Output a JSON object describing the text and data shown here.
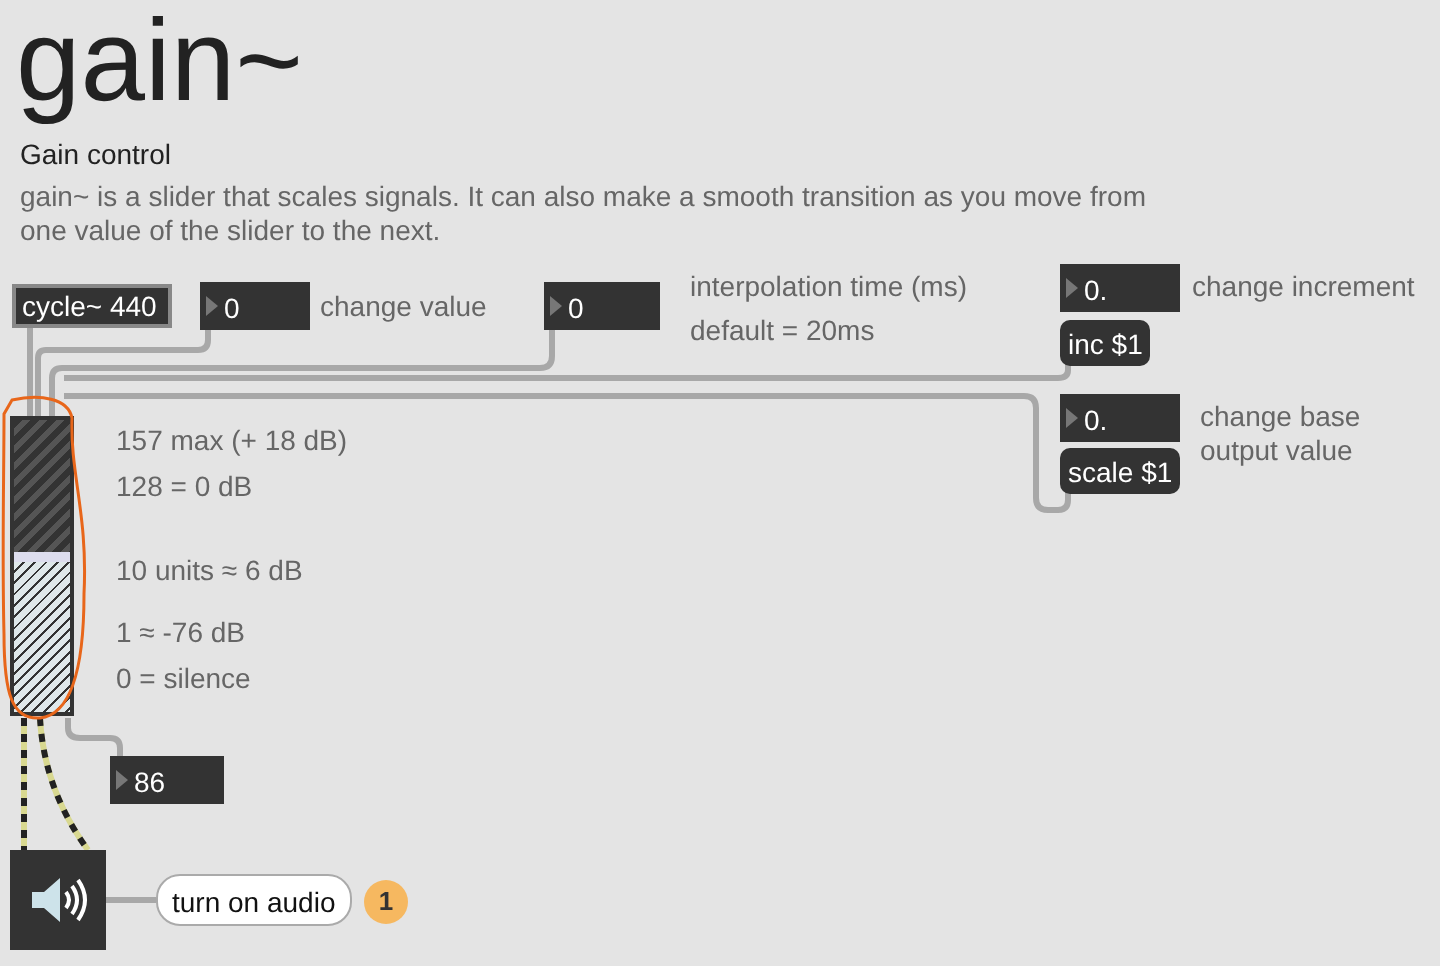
{
  "title": "gain~",
  "subtitle": "Gain control",
  "description": "gain~ is a slider that scales signals. It can also make a smooth transition as you move from one value of the slider to the next.",
  "boxes": [
    {
      "kind": "object",
      "text": "cycle~ 440"
    },
    {
      "kind": "number",
      "text": "0"
    },
    {
      "kind": "comment",
      "text": "change value"
    },
    {
      "kind": "number",
      "text": "0"
    },
    {
      "kind": "comment",
      "text": "interpolation time (ms)"
    },
    {
      "kind": "comment",
      "text": "default = 20ms"
    },
    {
      "kind": "number",
      "text": "0."
    },
    {
      "kind": "comment",
      "text": "change increment"
    },
    {
      "kind": "message",
      "text": "inc $1"
    },
    {
      "kind": "number",
      "text": "0."
    },
    {
      "kind": "comment",
      "text": "change base output value"
    },
    {
      "kind": "message",
      "text": "scale $1"
    },
    {
      "kind": "comment",
      "text": "157 max (+ 18 dB)"
    },
    {
      "kind": "comment",
      "text": "128 = 0 dB"
    },
    {
      "kind": "comment",
      "text": "10 units ≈ 6 dB"
    },
    {
      "kind": "comment",
      "text": "1 ≈ -76 dB"
    },
    {
      "kind": "comment",
      "text": "0 = silence"
    },
    {
      "kind": "number",
      "text": "86"
    },
    {
      "kind": "bubble",
      "text": "turn on audio"
    },
    {
      "kind": "badge",
      "text": "1"
    }
  ],
  "slider": {
    "level": 0.55
  },
  "audio": {
    "on": false
  }
}
